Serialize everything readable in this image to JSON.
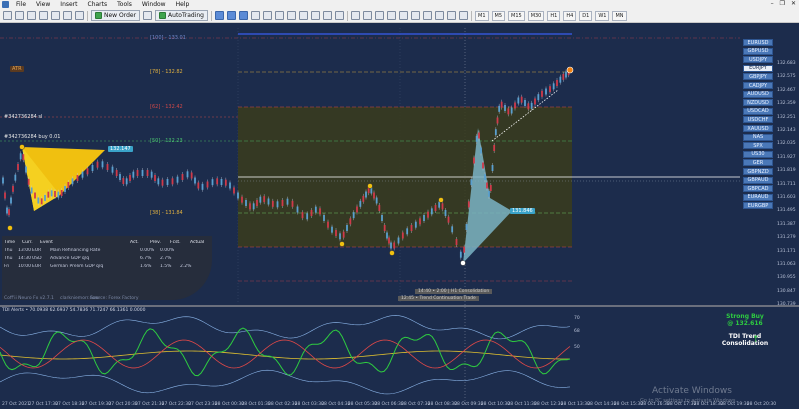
{
  "menu": {
    "items": [
      "File",
      "View",
      "Insert",
      "Charts",
      "Tools",
      "Window",
      "Help"
    ]
  },
  "toolbar": {
    "new_order_label": "New Order",
    "autotrading_label": "AutoTrading",
    "timeframes": [
      "M1",
      "M5",
      "M15",
      "M30",
      "H1",
      "H4",
      "D1",
      "W1",
      "MN"
    ]
  },
  "chart": {
    "symbol_tag": "ATR",
    "fib_labels": [
      {
        "text": "[100] - 133.01",
        "color": "#6f86c8"
      },
      {
        "text": "[78] - 132.82",
        "color": "#e0b040"
      },
      {
        "text": "[62] - 132.42",
        "color": "#d04848"
      },
      {
        "text": "[50] - 132.23",
        "color": "#48c070"
      },
      {
        "text": "[38] - 131.84",
        "color": "#e0b040"
      }
    ],
    "order_labels": [
      "#342736284 sl",
      "#342736284 buy 0.01"
    ],
    "price_tags": [
      {
        "text": "132.147",
        "color": "#3aa3c9"
      },
      {
        "text": "131.846",
        "color": "#3aa3c9"
      }
    ],
    "price_axis": [
      "132.683",
      "132.575",
      "132.467",
      "132.359",
      "132.251",
      "132.143",
      "132.035",
      "131.927",
      "131.819",
      "131.711",
      "131.603",
      "131.495",
      "131.387",
      "131.279",
      "131.171",
      "131.063",
      "130.955",
      "130.847",
      "130.739"
    ],
    "time_axis": [
      "27 Oct 2021",
      "27 Oct 17:30",
      "27 Oct 18:30",
      "27 Oct 19:30",
      "27 Oct 20:30",
      "27 Oct 21:30",
      "27 Oct 22:30",
      "27 Oct 23:30",
      "28 Oct 00:30",
      "28 Oct 01:30",
      "28 Oct 02:30",
      "28 Oct 03:30",
      "28 Oct 04:30",
      "28 Oct 05:30",
      "28 Oct 06:30",
      "28 Oct 07:30",
      "28 Oct 08:30",
      "28 Oct 09:30",
      "28 Oct 10:30",
      "28 Oct 11:30",
      "28 Oct 12:30",
      "28 Oct 13:30",
      "28 Oct 14:30",
      "28 Oct 15:30",
      "28 Oct 16:30",
      "28 Oct 17:30",
      "28 Oct 18:30",
      "28 Oct 19:30",
      "28 Oct 20:30"
    ],
    "captions": {
      "bottom_left": "Coff'ii Neuro Fx v2.7.1",
      "bottom_mid1": "clarkniemorr.com",
      "bottom_mid2": "Source: Forex Factory",
      "box_label1": "14:40 • 2:00 | H1 Consolidation",
      "box_label2": "12:45 • Trend Continuation Trade"
    }
  },
  "pairs": [
    "EURUSD",
    "GBPUSD",
    "USDJPY",
    "EURJPY",
    "GBPJPY",
    "CADJPY",
    "AUDUSD",
    "NZDUSD",
    "USDCAD",
    "USDCHF",
    "XAUUSD",
    "NAS",
    "SPX",
    "US30",
    "GER",
    "GBPNZD",
    "GBPAUD",
    "GBPCAD",
    "EURAUD",
    "EURGBP"
  ],
  "active_pair": "EURJPY",
  "news": {
    "headers": [
      "Time",
      "Curr.",
      "Event",
      "Act.",
      "Prev.",
      "Fcst.",
      "Actual"
    ],
    "rows": [
      [
        "Thu",
        "13:00",
        "EUR",
        "Main Refinancing Rate",
        "0.00%",
        "0.00%",
        ""
      ],
      [
        "Thu",
        "14:30",
        "USD",
        "Advance GDP q/q",
        "6.7%",
        "2.7%",
        ""
      ],
      [
        "Fri",
        "10:00",
        "EUR",
        "German Prelim GDP q/q",
        "1.6%",
        "1.5%",
        "2.2%"
      ]
    ]
  },
  "tdi": {
    "title": "TDI Alerts • 70.0938 62.6937 54.7836 71.7247 66.1361 0.0000",
    "levels": [
      "70",
      "68",
      "50"
    ],
    "signal": "Strong Buy",
    "price": "@ 132.616",
    "trend_label": "TDI Trend",
    "state_label": "Consolidation",
    "colors": {
      "signal": "#2ecc40",
      "text": "#ffffff"
    }
  },
  "watermark": {
    "title": "Activate Windows",
    "subtitle": "Go to PC settings to activate Windows."
  }
}
